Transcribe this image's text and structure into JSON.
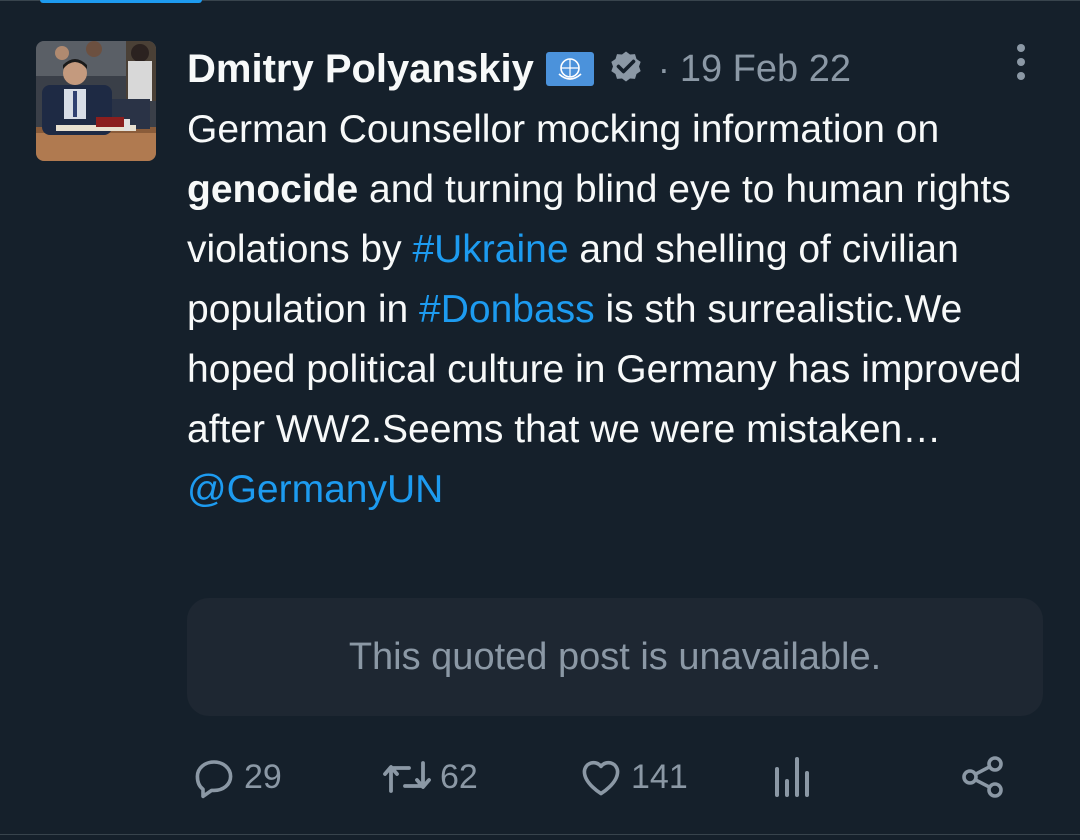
{
  "author": {
    "name": "Dmitry Polyanskiy",
    "flag_icon": "un-flag-icon",
    "verified_icon": "verified-badge-icon",
    "separator": "·",
    "date": "19 Feb 22"
  },
  "tweet": {
    "segments": [
      {
        "text": "German Counsellor mocking information on ",
        "style": "normal"
      },
      {
        "text": "genocide",
        "style": "bold"
      },
      {
        "text": " and turning blind eye to human rights violations by ",
        "style": "normal"
      },
      {
        "text": "#Ukraine",
        "style": "link"
      },
      {
        "text": " and shelling of civilian population in ",
        "style": "normal"
      },
      {
        "text": "#Donbass",
        "style": "link"
      },
      {
        "text": " is sth surrealistic.We hoped political culture in Germany has improved after WW2.Seems that we were mistaken… ",
        "style": "normal"
      },
      {
        "text": "@GermanyUN",
        "style": "link"
      }
    ]
  },
  "quote": {
    "text": "This quoted post is unavailable."
  },
  "actions": {
    "replies": "29",
    "reposts": "62",
    "likes": "141"
  },
  "colors": {
    "background": "#15202b",
    "text": "#f7f9f9",
    "muted": "#8b98a5",
    "link": "#1d9bf0",
    "quote_bg": "#1e2732"
  }
}
